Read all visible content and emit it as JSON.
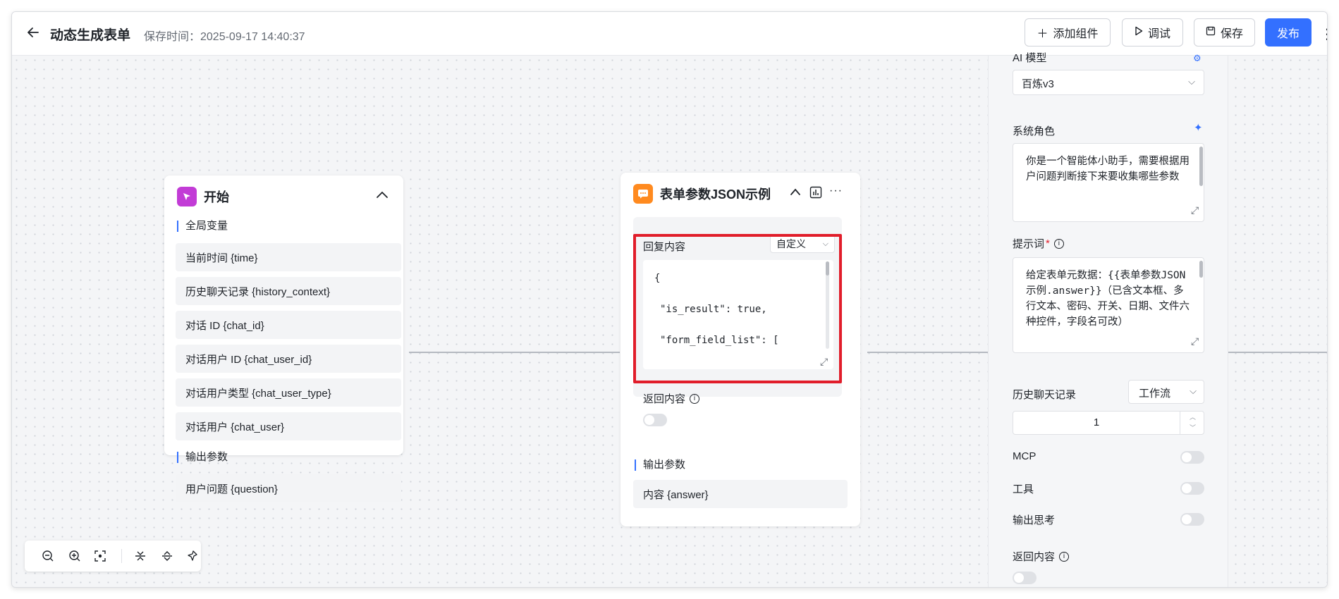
{
  "header": {
    "back_icon": "arrow-left-icon",
    "title": "动态生成表单",
    "save_time": "保存时间：2025-09-17 14:40:37",
    "buttons": {
      "add_component": "添加组件",
      "debug": "调试",
      "save": "保存",
      "publish": "发布"
    }
  },
  "start_node": {
    "title": "开始",
    "global_vars_label": "全局变量",
    "global_vars": [
      "当前时间 {time}",
      "历史聊天记录 {history_context}",
      "对话 ID {chat_id}",
      "对话用户 ID {chat_user_id}",
      "对话用户类型 {chat_user_type}",
      "对话用户 {chat_user}"
    ],
    "output_label": "输出参数",
    "outputs": [
      "用户问题 {question}"
    ]
  },
  "reply_node": {
    "title": "表单参数JSON示例",
    "reply_label": "回复内容",
    "reply_mode": "自定义",
    "code_lines": [
      "{",
      "\"is_result\": true,",
      "\"form_field_list\": ["
    ],
    "return_label": "返回内容",
    "return_enabled": false,
    "output_label": "输出参数",
    "outputs": [
      "内容 {answer}"
    ]
  },
  "right_panel": {
    "ai_model_label": "AI 模型",
    "ai_model_value": "百炼v3",
    "system_role_label": "系统角色",
    "system_role_text": "你是一个智能体小助手，需要根据用户问题判断接下来要收集哪些参数",
    "prompt_label": "提示词",
    "prompt_required": "*",
    "prompt_text": "给定表单元数据：{{表单参数JSON示例.answer}}（已含文本框、多行文本、密码、开关、日期、文件六种控件，字段名可改）",
    "history_label": "历史聊天记录",
    "history_mode": "工作流",
    "history_count": "1",
    "mcp_label": "MCP",
    "mcp_enabled": false,
    "tools_label": "工具",
    "tools_enabled": false,
    "output_thinking_label": "输出思考",
    "output_thinking_enabled": false,
    "return_label": "返回内容",
    "return_enabled": false
  },
  "colors": {
    "accent": "#3370ff",
    "start_icon_bg": "#c23cd6",
    "reply_icon_bg": "#ff8a1f",
    "highlight_border": "#e11d2a"
  }
}
